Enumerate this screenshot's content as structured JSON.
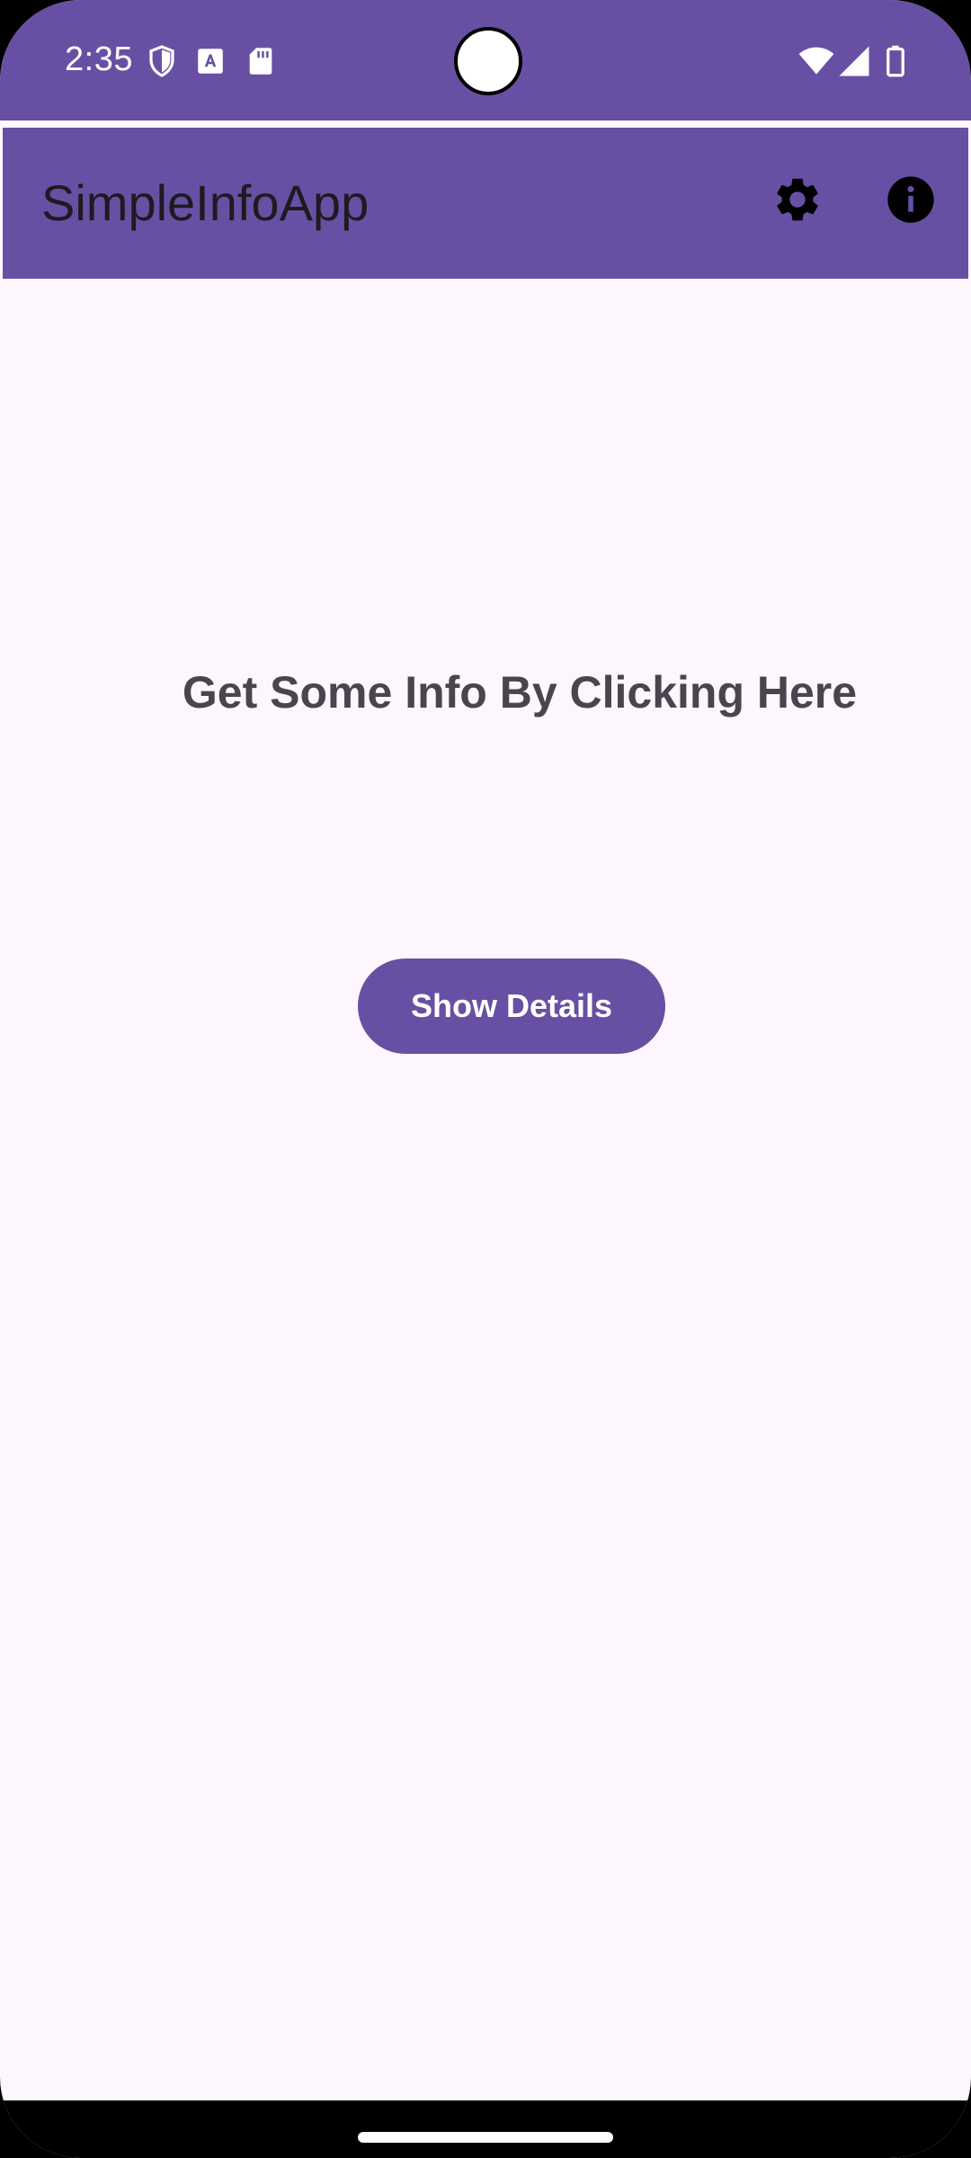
{
  "status_bar": {
    "time": "2:35",
    "left_icons": [
      "shield-icon",
      "text-a-icon",
      "sd-card-icon"
    ],
    "right_icons": [
      "wifi-icon",
      "signal-icon",
      "battery-icon"
    ],
    "background": "#6750A4"
  },
  "app_bar": {
    "title": "SimpleInfoApp",
    "actions": [
      "settings-icon",
      "info-icon"
    ],
    "background": "#6750A4"
  },
  "main": {
    "headline": "Get Some Info By Clicking Here",
    "button_label": "Show Details"
  },
  "colors": {
    "primary": "#6750A4",
    "surface": "#FDF6FD",
    "headline_text": "#49454F",
    "title_text": "#1D1B20"
  }
}
